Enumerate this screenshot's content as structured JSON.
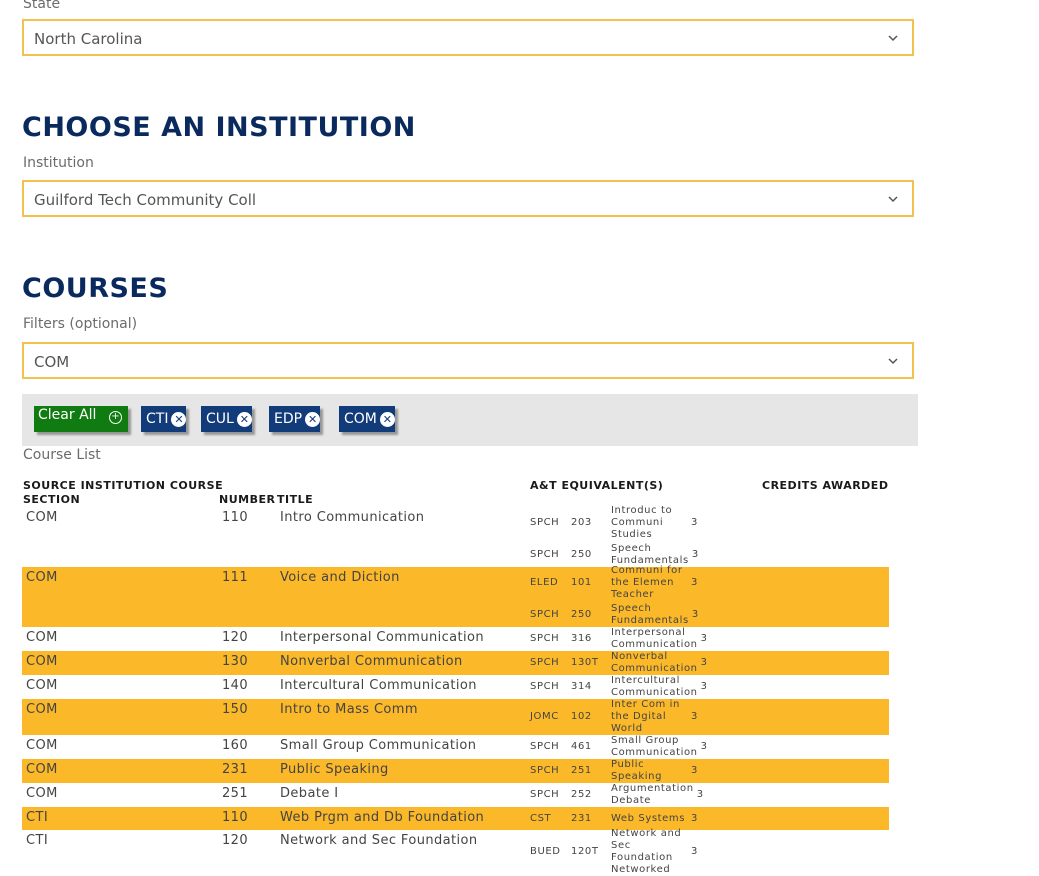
{
  "state_section": {
    "label": "State",
    "value": "North Carolina"
  },
  "institution_section": {
    "heading": "CHOOSE AN INSTITUTION",
    "label": "Institution",
    "value": "Guilford Tech Community Coll"
  },
  "courses_section": {
    "heading": "COURSES",
    "filters_label": "Filters (optional)",
    "filters_value": "COM",
    "clear_all_label": "Clear All",
    "chips": [
      "CTI",
      "CUL",
      "EDP",
      "COM"
    ],
    "course_list_label": "Course List"
  },
  "table": {
    "headers": {
      "source_line1": "SOURCE INSTITUTION COURSE",
      "source_line2": "SECTION",
      "number": "NUMBER",
      "title": "TITLE",
      "equiv": "A&T EQUIVALENT(S)",
      "credits": "CREDITS AWARDED"
    },
    "rows": [
      {
        "section": "COM",
        "number": "110",
        "title": "Intro Communication",
        "equivs": [
          {
            "dept": "SPCH",
            "num": "203",
            "title": [
              "Introduc to",
              "Communi",
              "Studies"
            ],
            "credits": "3"
          },
          {
            "dept": "SPCH",
            "num": "250",
            "title": [
              "Speech",
              "Fundamentals"
            ],
            "credits": "3"
          }
        ]
      },
      {
        "section": "COM",
        "number": "111",
        "title": "Voice and Diction",
        "equivs": [
          {
            "dept": "ELED",
            "num": "101",
            "title": [
              "Communi for",
              "the Elemen",
              "Teacher"
            ],
            "credits": "3"
          },
          {
            "dept": "SPCH",
            "num": "250",
            "title": [
              "Speech",
              "Fundamentals"
            ],
            "credits": "3"
          }
        ]
      },
      {
        "section": "COM",
        "number": "120",
        "title": "Interpersonal Communication",
        "equivs": [
          {
            "dept": "SPCH",
            "num": "316",
            "title": [
              "Interpersonal",
              "Communication"
            ],
            "credits": "3"
          }
        ]
      },
      {
        "section": "COM",
        "number": "130",
        "title": "Nonverbal Communication",
        "equivs": [
          {
            "dept": "SPCH",
            "num": "130T",
            "title": [
              "Nonverbal",
              "Communication"
            ],
            "credits": "3"
          }
        ]
      },
      {
        "section": "COM",
        "number": "140",
        "title": "Intercultural Communication",
        "equivs": [
          {
            "dept": "SPCH",
            "num": "314",
            "title": [
              "Intercultural",
              "Communication"
            ],
            "credits": "3"
          }
        ]
      },
      {
        "section": "COM",
        "number": "150",
        "title": "Intro to Mass Comm",
        "equivs": [
          {
            "dept": "JOMC",
            "num": "102",
            "title": [
              "Inter Com in",
              "the Dgital",
              "World"
            ],
            "credits": "3"
          }
        ]
      },
      {
        "section": "COM",
        "number": "160",
        "title": "Small Group Communication",
        "equivs": [
          {
            "dept": "SPCH",
            "num": "461",
            "title": [
              "Small Group",
              "Communication"
            ],
            "credits": "3"
          }
        ]
      },
      {
        "section": "COM",
        "number": "231",
        "title": "Public Speaking",
        "equivs": [
          {
            "dept": "SPCH",
            "num": "251",
            "title": [
              "Public",
              "Speaking"
            ],
            "credits": "3"
          }
        ]
      },
      {
        "section": "COM",
        "number": "251",
        "title": "Debate I",
        "equivs": [
          {
            "dept": "SPCH",
            "num": "252",
            "title": [
              "Argumentation",
              "Debate"
            ],
            "credits": "3"
          }
        ]
      },
      {
        "section": "CTI",
        "number": "110",
        "title": "Web Prgm and Db Foundation",
        "equivs": [
          {
            "dept": "CST",
            "num": "231",
            "title": [
              "Web Systems"
            ],
            "credits": "3"
          }
        ]
      },
      {
        "section": "CTI",
        "number": "120",
        "title": "Network and Sec Foundation",
        "equivs": [
          {
            "dept": "BUED",
            "num": "120T",
            "title": [
              "Network and",
              "Sec",
              "Foundation",
              "Networked"
            ],
            "credits": "3"
          }
        ]
      }
    ]
  }
}
